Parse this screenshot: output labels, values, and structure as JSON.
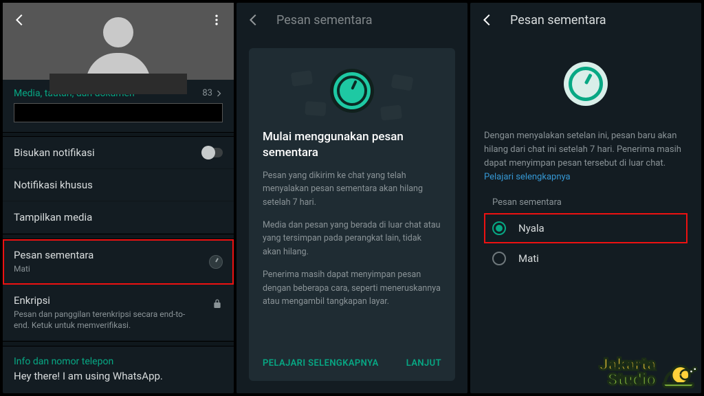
{
  "screen1": {
    "media_label": "Media, tautan, dan dokumen",
    "media_count": "83",
    "mute": "Bisukan notifikasi",
    "custom_notif": "Notifikasi khusus",
    "show_media": "Tampilkan media",
    "disappearing": {
      "title": "Pesan sementara",
      "sub": "Mati"
    },
    "encryption": {
      "title": "Enkripsi",
      "sub": "Pesan dan panggilan terenkripsi secara end-to-end. Ketuk untuk memverifikasi."
    },
    "info_label": "Info dan nomor telepon",
    "info_text": "Hey there! I am using WhatsApp."
  },
  "screen2": {
    "header": "Pesan sementara",
    "modal": {
      "heading": "Mulai menggunakan pesan sementara",
      "p1": "Pesan yang dikirim ke chat yang telah menyalakan pesan sementara akan hilang setelah 7 hari.",
      "p2": "Media dan pesan yang berada di luar chat atau yang tersimpan pada perangkat lain, tidak akan hilang.",
      "p3": "Penerima masih dapat menyimpan pesan dengan beberapa cara, seperti meneruskannya atau mengambil tangkapan layar.",
      "learn": "PELAJARI SELENGKAPNYA",
      "next": "LANJUT"
    }
  },
  "screen3": {
    "header": "Pesan sementara",
    "desc_1": "Dengan menyalakan setelan ini, pesan baru akan hilang dari chat ini setelah 7 hari. Penerima masih dapat menyimpan pesan tersebut di luar chat. ",
    "desc_link": "Pelajari selengkapnya",
    "group_label": "Pesan sementara",
    "on": "Nyala",
    "off": "Mati"
  },
  "watermark": {
    "line1": "Jakarta",
    "line2": "Studio"
  }
}
